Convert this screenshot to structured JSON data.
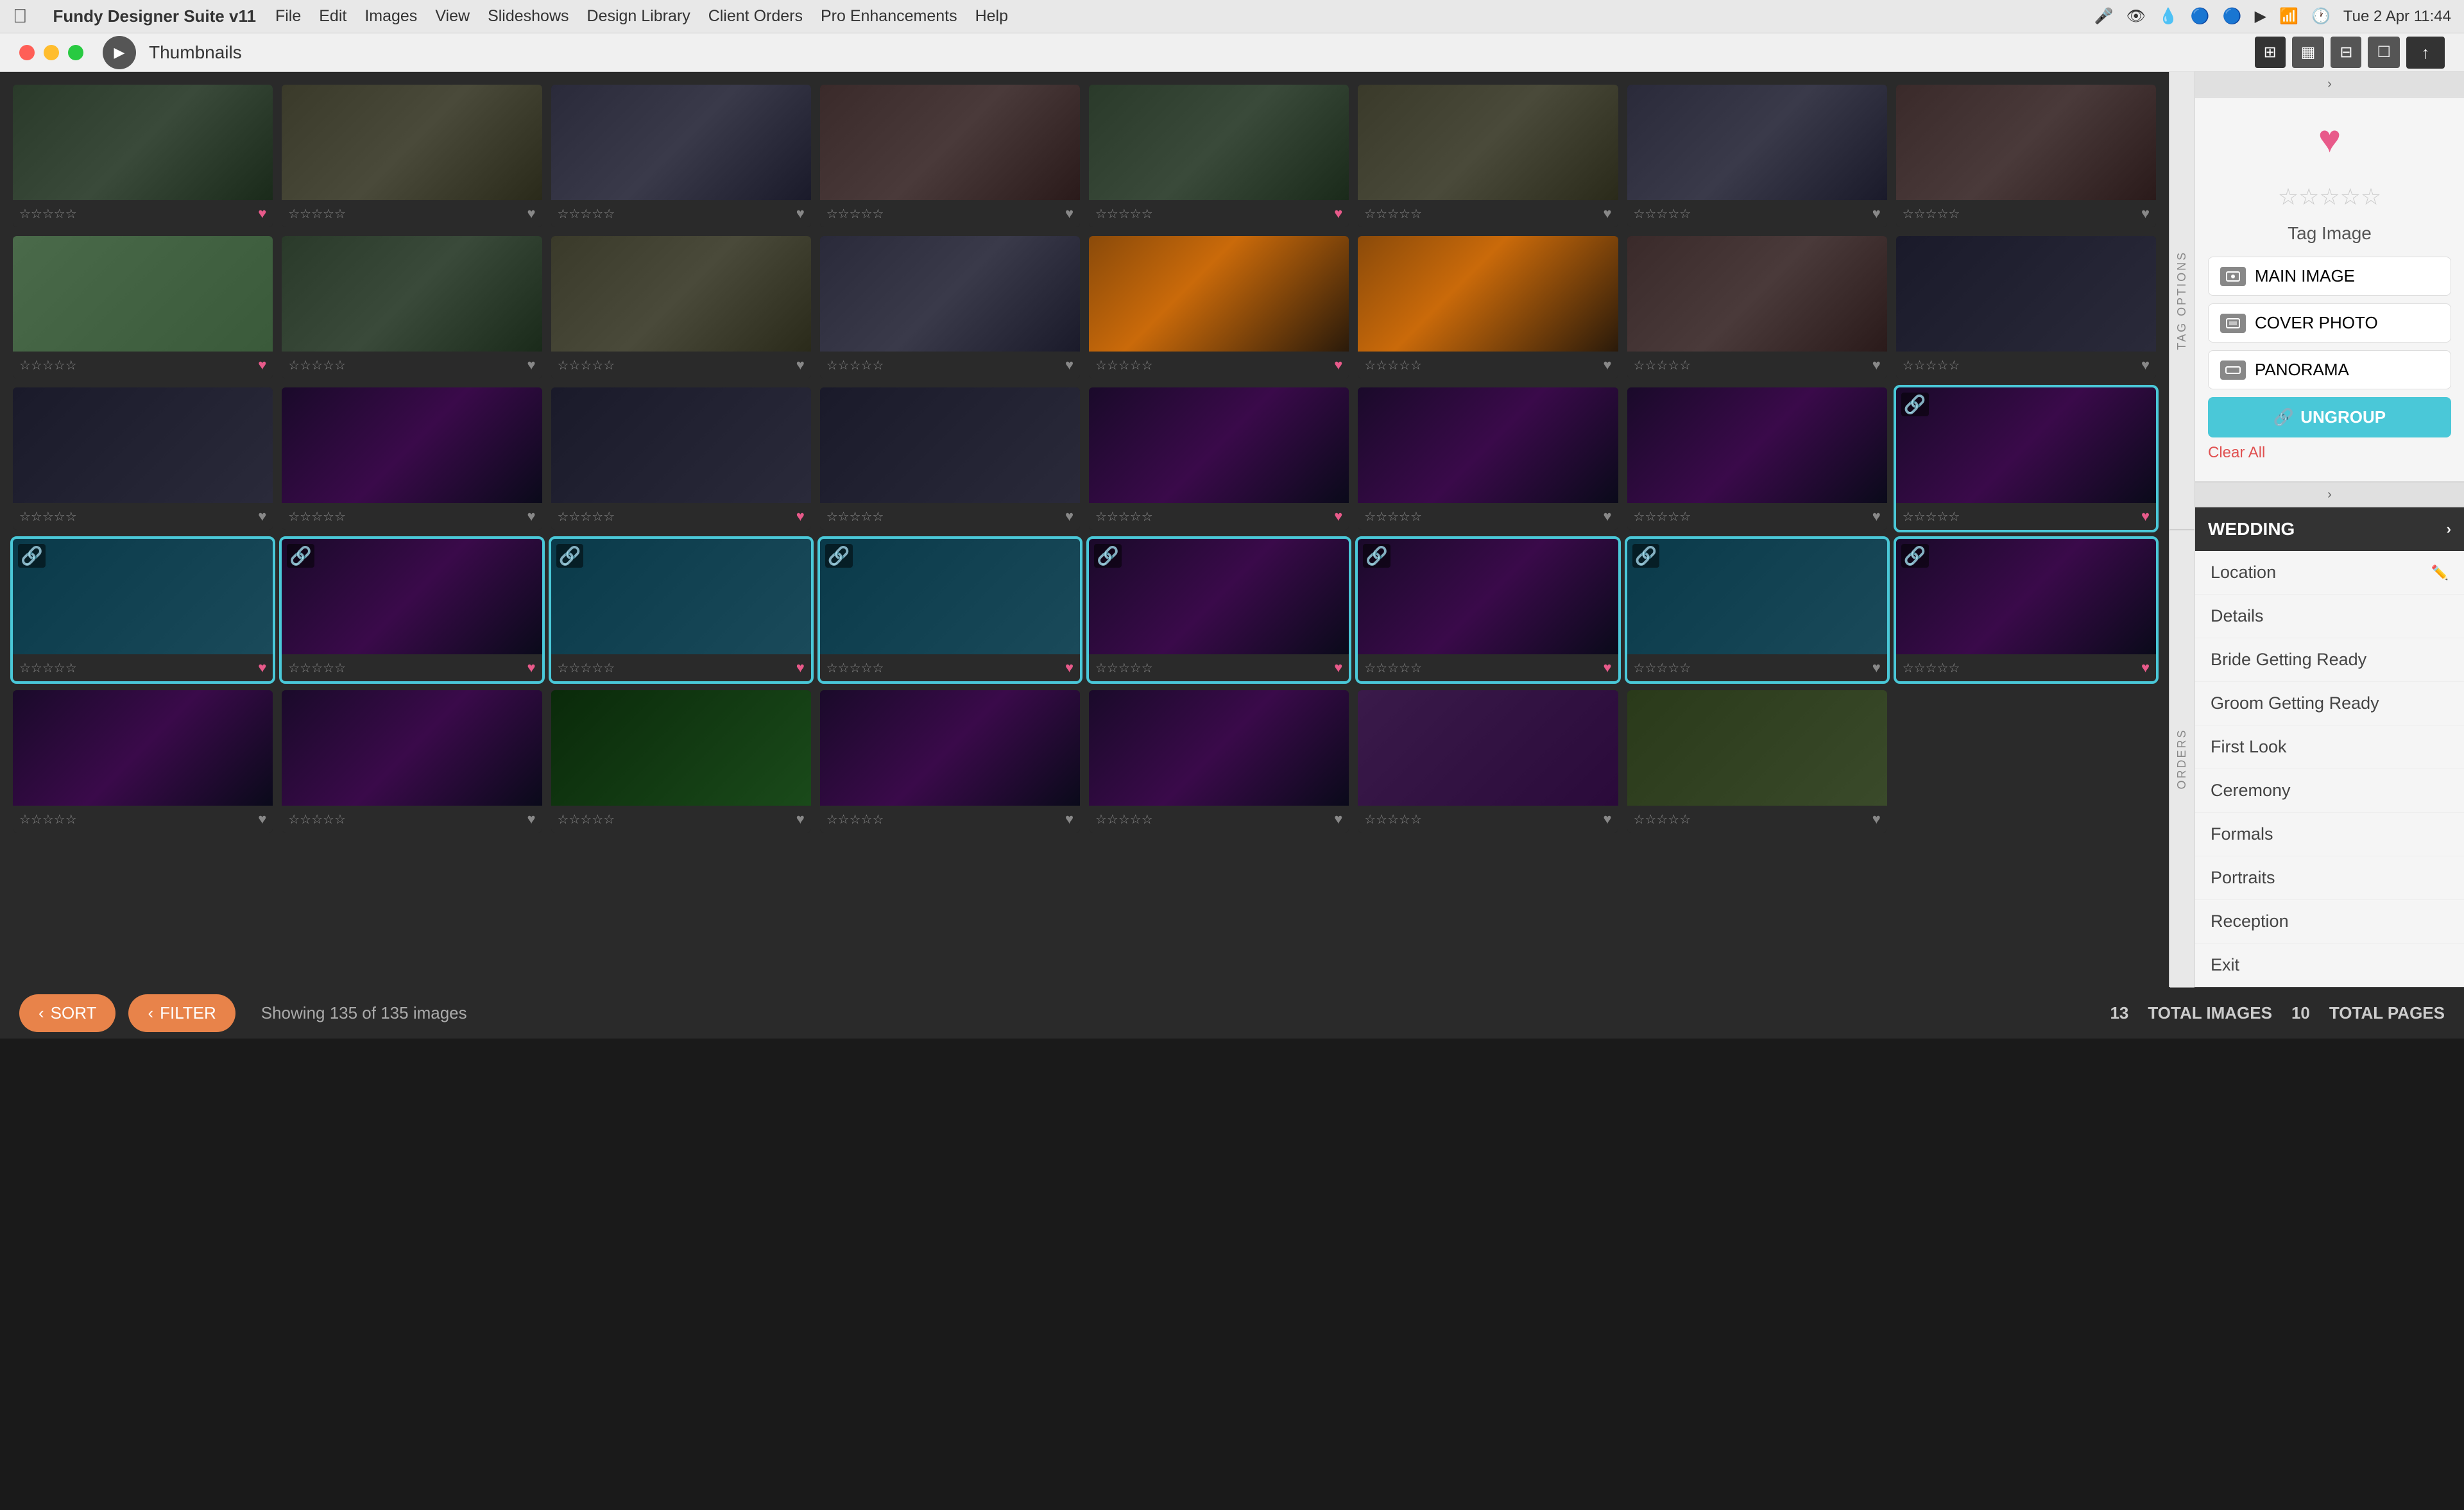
{
  "menubar": {
    "app_name": "Fundy Designer Suite v11",
    "menus": [
      "File",
      "Edit",
      "Images",
      "View",
      "Slideshows",
      "Design Library",
      "Client Orders",
      "Pro Enhancements",
      "Help"
    ],
    "date_time": "Tue 2 Apr  11:44"
  },
  "toolbar": {
    "thumbnails_label": "Thumbnails"
  },
  "grid": {
    "images_count": 135,
    "total_images_label": "TOTAL IMAGES",
    "total_pages_label": "TOTAL PAGES",
    "total_images": 13,
    "total_pages": 10
  },
  "right_panel": {
    "tag_options_label": "TAG OPTIONS",
    "orders_label": "ORDERS",
    "tag_image_label": "Tag Image",
    "buttons": {
      "main_image": "MAIN IMAGE",
      "cover_photo": "COVER PHOTO",
      "panorama": "PANORAMA",
      "ungroup": "UNGROUP",
      "clear_all": "Clear All"
    },
    "wedding_label": "WEDDING",
    "categories": [
      {
        "name": "Location",
        "editable": true
      },
      {
        "name": "Details",
        "editable": false
      },
      {
        "name": "Bride Getting Ready",
        "editable": false
      },
      {
        "name": "Groom Getting Ready",
        "editable": false
      },
      {
        "name": "First Look",
        "editable": false
      },
      {
        "name": "Ceremony",
        "editable": false
      },
      {
        "name": "Formals",
        "editable": false
      },
      {
        "name": "Portraits",
        "editable": false
      },
      {
        "name": "Reception",
        "editable": false
      },
      {
        "name": "Exit",
        "editable": false
      }
    ]
  },
  "bottom_bar": {
    "sort_label": "SORT",
    "filter_label": "FILTER",
    "showing_text": "Showing 135 of 135 images"
  },
  "rows": [
    {
      "images": [
        {
          "bg": "photo-1",
          "heart": true,
          "selected": false,
          "linked": false
        },
        {
          "bg": "photo-2",
          "heart": false,
          "selected": false,
          "linked": false
        },
        {
          "bg": "photo-3",
          "heart": false,
          "selected": false,
          "linked": false
        },
        {
          "bg": "photo-4",
          "heart": false,
          "selected": false,
          "linked": false
        },
        {
          "bg": "photo-1",
          "heart": true,
          "selected": false,
          "linked": false
        },
        {
          "bg": "photo-2",
          "heart": false,
          "selected": false,
          "linked": false
        },
        {
          "bg": "photo-3",
          "heart": false,
          "selected": false,
          "linked": false
        },
        {
          "bg": "photo-4",
          "heart": false,
          "selected": false,
          "linked": false
        }
      ]
    },
    {
      "images": [
        {
          "bg": "photo-bright",
          "heart": true,
          "selected": false,
          "linked": false
        },
        {
          "bg": "photo-1",
          "heart": false,
          "selected": false,
          "linked": false
        },
        {
          "bg": "photo-2",
          "heart": false,
          "selected": false,
          "linked": false
        },
        {
          "bg": "photo-3",
          "heart": false,
          "selected": false,
          "linked": false
        },
        {
          "bg": "photo-sunset",
          "heart": true,
          "selected": false,
          "linked": false
        },
        {
          "bg": "photo-sunset",
          "heart": false,
          "selected": false,
          "linked": false
        },
        {
          "bg": "photo-4",
          "heart": false,
          "selected": false,
          "linked": false
        },
        {
          "bg": "photo-5",
          "heart": false,
          "selected": false,
          "linked": false
        }
      ]
    },
    {
      "images": [
        {
          "bg": "photo-5",
          "heart": false,
          "selected": false,
          "linked": false
        },
        {
          "bg": "photo-dance",
          "heart": false,
          "selected": false,
          "linked": false
        },
        {
          "bg": "photo-5",
          "heart": true,
          "selected": false,
          "linked": false
        },
        {
          "bg": "photo-5",
          "heart": false,
          "selected": false,
          "linked": false
        },
        {
          "bg": "photo-dance",
          "heart": true,
          "selected": false,
          "linked": false
        },
        {
          "bg": "photo-dance",
          "heart": false,
          "selected": false,
          "linked": false
        },
        {
          "bg": "photo-dance",
          "heart": false,
          "selected": false,
          "linked": false
        },
        {
          "bg": "photo-dance",
          "heart": true,
          "selected": true,
          "linked": true
        }
      ]
    },
    {
      "images": [
        {
          "bg": "photo-teal",
          "heart": true,
          "selected": true,
          "linked": true
        },
        {
          "bg": "photo-dance",
          "heart": true,
          "selected": true,
          "linked": true
        },
        {
          "bg": "photo-teal",
          "heart": true,
          "selected": true,
          "linked": true
        },
        {
          "bg": "photo-teal",
          "heart": true,
          "selected": true,
          "linked": true
        },
        {
          "bg": "photo-dance",
          "heart": true,
          "selected": true,
          "linked": true
        },
        {
          "bg": "photo-dance",
          "heart": true,
          "selected": true,
          "linked": true
        },
        {
          "bg": "photo-teal",
          "heart": false,
          "selected": true,
          "linked": true
        },
        {
          "bg": "photo-dance",
          "heart": true,
          "selected": true,
          "linked": true
        }
      ]
    },
    {
      "images": [
        {
          "bg": "photo-dance",
          "heart": false,
          "selected": false,
          "linked": false
        },
        {
          "bg": "photo-dance",
          "heart": false,
          "selected": false,
          "linked": false
        },
        {
          "bg": "photo-dance",
          "heart": false,
          "selected": false,
          "linked": false
        },
        {
          "bg": "photo-dance",
          "heart": false,
          "selected": false,
          "linked": false
        },
        {
          "bg": "photo-dance",
          "heart": false,
          "selected": false,
          "linked": false
        },
        {
          "bg": "photo-dance",
          "heart": false,
          "selected": false,
          "linked": false
        },
        {
          "bg": "photo-dance",
          "heart": false,
          "selected": false,
          "linked": false
        },
        {
          "bg": null,
          "heart": false,
          "selected": false,
          "linked": false
        }
      ]
    }
  ]
}
